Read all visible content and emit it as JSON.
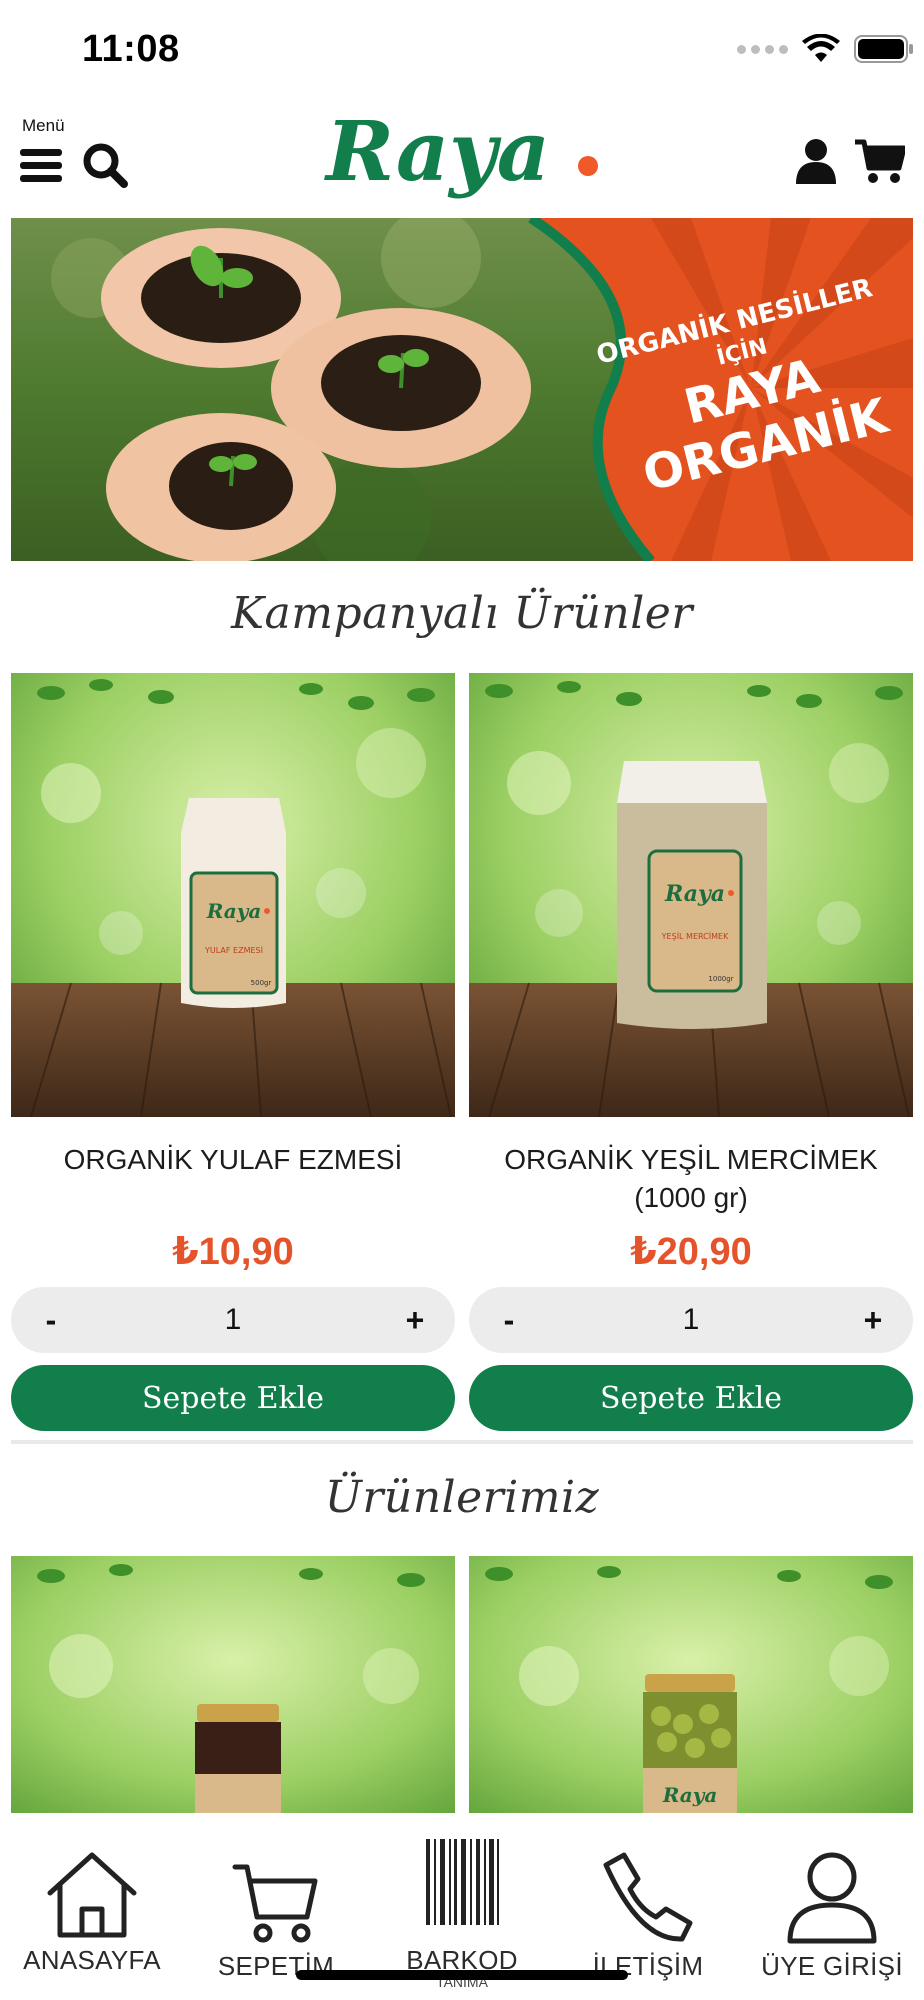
{
  "status_bar": {
    "time": "11:08"
  },
  "header": {
    "menu_label": "Menü",
    "logo_text": "Raya",
    "logo_dot_color": "#f05a28",
    "brand_green": "#127e4c"
  },
  "banner": {
    "line1": "ORGANİK NESİLLER",
    "line2": "İÇİN",
    "line3": "RAYA",
    "line4": "ORGANİK"
  },
  "campaign": {
    "title": "Kampanyalı Ürünler",
    "products": [
      {
        "name": "ORGANİK YULAF EZMESİ",
        "price": "₺10,90",
        "quantity": "1",
        "minus": "-",
        "plus": "+",
        "add_label": "Sepete Ekle",
        "package_label": "YULAF EZMESİ",
        "package_weight": "500gr"
      },
      {
        "name": "ORGANİK YEŞİL MERCİMEK (1000 gr)",
        "price": "₺20,90",
        "quantity": "1",
        "minus": "-",
        "plus": "+",
        "add_label": "Sepete Ekle",
        "package_label": "YEŞİL MERCİMEK",
        "package_weight": "1000gr"
      }
    ]
  },
  "products_section": {
    "title": "Ürünlerimiz"
  },
  "tabbar": {
    "items": [
      {
        "label": "ANASAYFA",
        "icon": "home-icon"
      },
      {
        "label": "SEPETİM",
        "icon": "cart-icon"
      },
      {
        "label": "BARKOD",
        "sublabel": "TANIMA",
        "icon": "barcode-icon"
      },
      {
        "label": "İLETİŞİM",
        "icon": "phone-icon"
      },
      {
        "label": "ÜYE GİRİŞİ",
        "icon": "user-icon"
      }
    ]
  },
  "colors": {
    "price": "#e5532b",
    "button": "#127e4c",
    "stepper_bg": "#ececec"
  }
}
